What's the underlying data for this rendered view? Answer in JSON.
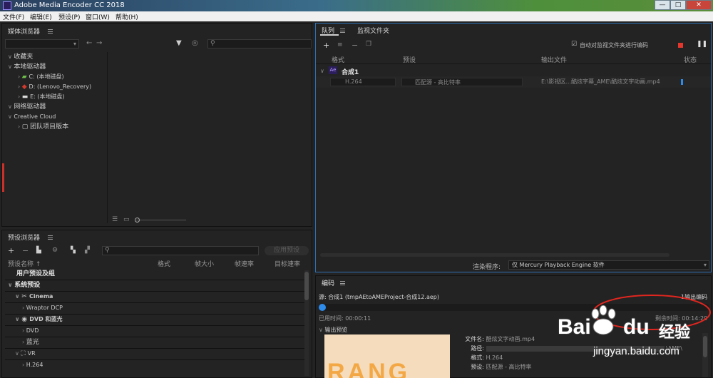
{
  "window": {
    "title": "Adobe Media Encoder CC 2018",
    "min": "—",
    "max": "□",
    "close": "✕"
  },
  "menu": [
    "文件(F)",
    "编辑(E)",
    "预设(P)",
    "窗口(W)",
    "帮助(H)"
  ],
  "media_browser": {
    "title": "媒体浏览器",
    "tree": [
      {
        "label": "收藏夹",
        "level": 0,
        "type": "section"
      },
      {
        "label": "本地驱动器",
        "level": 0,
        "type": "section"
      },
      {
        "label": "C: (本地磁盘)",
        "level": 1,
        "type": "drive"
      },
      {
        "label": "D: (Lenovo_Recovery)",
        "level": 1,
        "type": "drive"
      },
      {
        "label": "E: (本地磁盘)",
        "level": 1,
        "type": "drive"
      },
      {
        "label": "网络驱动器",
        "level": 0,
        "type": "section"
      },
      {
        "label": "Creative Cloud",
        "level": 0,
        "type": "section"
      },
      {
        "label": "团队项目版本",
        "level": 1,
        "type": "item"
      }
    ]
  },
  "preset_browser": {
    "title": "预设浏览器",
    "apply_label": "应用预设",
    "columns": [
      "预设名称 ↑",
      "格式",
      "帧大小",
      "帧速率",
      "目标速率"
    ],
    "rows": [
      {
        "label": "用户预设及组",
        "level": 0,
        "bold": true
      },
      {
        "label": "系统预设",
        "level": 0,
        "bold": true
      },
      {
        "label": "Cinema",
        "level": 1
      },
      {
        "label": "Wraptor DCP",
        "level": 2
      },
      {
        "label": "DVD 和蓝光",
        "level": 1
      },
      {
        "label": "DVD",
        "level": 2
      },
      {
        "label": "蓝光",
        "level": 2
      },
      {
        "label": "VR",
        "level": 1
      },
      {
        "label": "H.264",
        "level": 2
      }
    ]
  },
  "queue": {
    "tabs": [
      "队列",
      "监视文件夹"
    ],
    "auto_encode_label": "自动对监视文件夹进行编码",
    "columns": [
      "格式",
      "预设",
      "输出文件",
      "状态"
    ],
    "group_name": "合成1",
    "item": {
      "format": "H.264",
      "preset": "匹配源 - 高比特率",
      "output": "E:\\影视区...酷炫字幕_AME\\酷炫文字动画.mp4"
    },
    "renderer_label": "渲染程序:",
    "renderer_value": "仅 Mercury Playback Engine 软件"
  },
  "encoding": {
    "title": "编码",
    "source": "源: 合成1 (tmpAEtoAMEProject-合成12.aep)",
    "outputs": "1输出编码",
    "elapsed": "已用时间: 00:00:11",
    "remaining": "剩余时间: 00:14:29",
    "progress_fraction": 0.01,
    "preview_label": "输出预览",
    "preview_text": "RANG",
    "details": [
      {
        "key": "文件名:",
        "value": "酷炫文字动画.mp4"
      },
      {
        "key": "路径:",
        "value": "\\AME\\"
      },
      {
        "key": "格式:",
        "value": "H.264"
      },
      {
        "key": "预设:",
        "value": "匹配源 - 高比特率"
      }
    ]
  },
  "watermark": {
    "brand": "Bai",
    "brand2": "du",
    "jingyan": "经验",
    "url": "jingyan.baidu.com"
  },
  "colors": {
    "accent_blue": "#2d8ceb",
    "stop_red": "#e3372e",
    "ae_purple": "#2b1d5e",
    "annotation_red": "#e0261f"
  }
}
